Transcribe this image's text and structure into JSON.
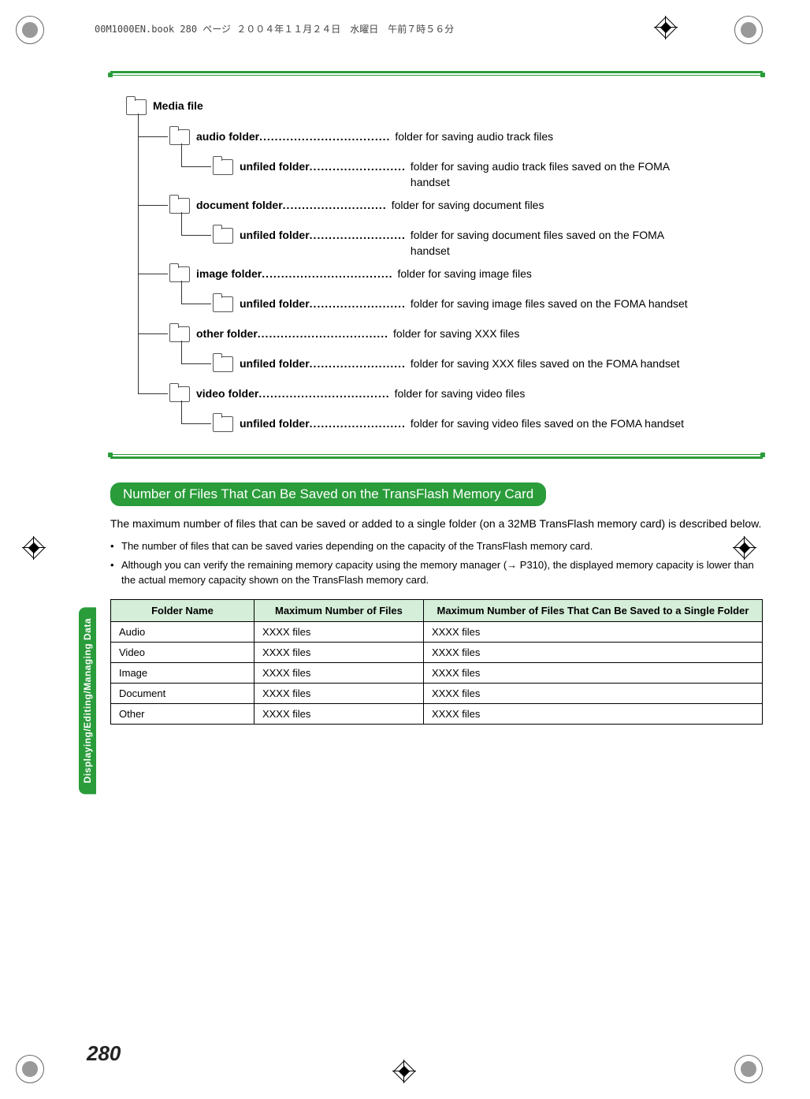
{
  "header_meta": "00M1000EN.book  280 ページ  ２００４年１１月２４日　水曜日　午前７時５６分",
  "side_tab": "Displaying/Editing/Managing Data",
  "page_number": "280",
  "tree": {
    "root": "Media file",
    "items": [
      {
        "label": "audio folder",
        "desc": "folder for saving audio track files"
      },
      {
        "label": "unfiled folder",
        "desc": "folder for saving audio track files saved on the FOMA handset"
      },
      {
        "label": "document folder",
        "desc": "folder for saving document files"
      },
      {
        "label": "unfiled folder",
        "desc": "folder for saving document files saved on the FOMA handset"
      },
      {
        "label": "image folder",
        "desc": "folder for saving image files"
      },
      {
        "label": "unfiled folder",
        "desc": "folder for saving image files saved on the FOMA handset"
      },
      {
        "label": "other folder",
        "desc": "folder for saving XXX files"
      },
      {
        "label": "unfiled folder",
        "desc": "folder for saving XXX files saved on the FOMA handset"
      },
      {
        "label": "video folder",
        "desc": "folder for saving video files"
      },
      {
        "label": "unfiled folder",
        "desc": "folder for saving video files saved on the FOMA handset"
      }
    ]
  },
  "section_heading": "Number of Files That Can Be Saved on the TransFlash Memory Card",
  "body_text": "The maximum number of files that can be saved or added to a single folder (on a 32MB TransFlash memory card) is described below.",
  "bullets": [
    "The number of files that can be saved varies depending on the capacity of the TransFlash memory card.",
    "Although you can verify the remaining memory capacity using the memory manager (→ P310), the displayed memory capacity is lower than the actual memory capacity shown on the TransFlash memory card."
  ],
  "table": {
    "headers": [
      "Folder Name",
      "Maximum Number of Files",
      "Maximum Number of Files That Can Be Saved to a Single Folder"
    ],
    "rows": [
      [
        "Audio",
        "XXXX files",
        "XXXX files"
      ],
      [
        "Video",
        "XXXX files",
        "XXXX files"
      ],
      [
        "Image",
        "XXXX files",
        "XXXX files"
      ],
      [
        "Document",
        "XXXX files",
        "XXXX files"
      ],
      [
        "Other",
        "XXXX files",
        "XXXX files"
      ]
    ]
  },
  "dots_short": "..................................",
  "dots_med": ".........................",
  "dots_long": "..........................."
}
